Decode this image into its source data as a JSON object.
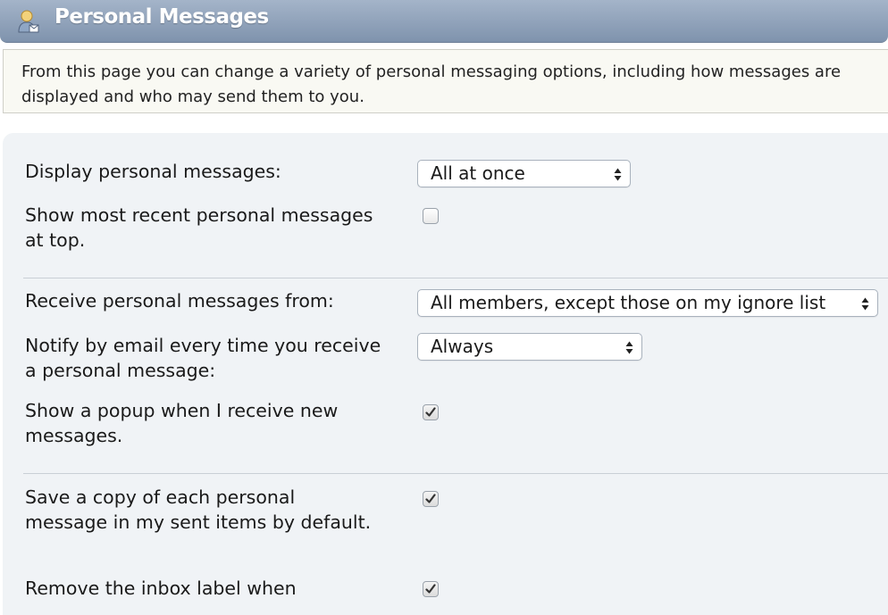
{
  "header": {
    "title": "Personal Messages",
    "icon": "user-messages-icon"
  },
  "description": "From this page you can change a variety of personal messaging options, including how messages are displayed and who may send them to you.",
  "settings": {
    "display": {
      "label": "Display personal messages:",
      "value": "All at once"
    },
    "recent_top": {
      "label": "Show most recent personal messages at top.",
      "checked": false
    },
    "receive_from": {
      "label": "Receive personal messages from:",
      "value": "All members, except those on my ignore list"
    },
    "notify": {
      "label": "Notify by email every time you receive a personal message:",
      "value": "Always"
    },
    "popup": {
      "label": "Show a popup when I receive new messages.",
      "checked": true
    },
    "save_copy": {
      "label": "Save a copy of each personal message in my sent items by default.",
      "checked": true
    },
    "remove_inbox": {
      "label": "Remove the inbox label when",
      "checked": true
    }
  },
  "colors": {
    "header_gradient_top": "#a4b4c9",
    "header_gradient_bottom": "#7f93ad",
    "panel_bg": "#f0f3f6",
    "description_bg": "#f9f9f3"
  }
}
